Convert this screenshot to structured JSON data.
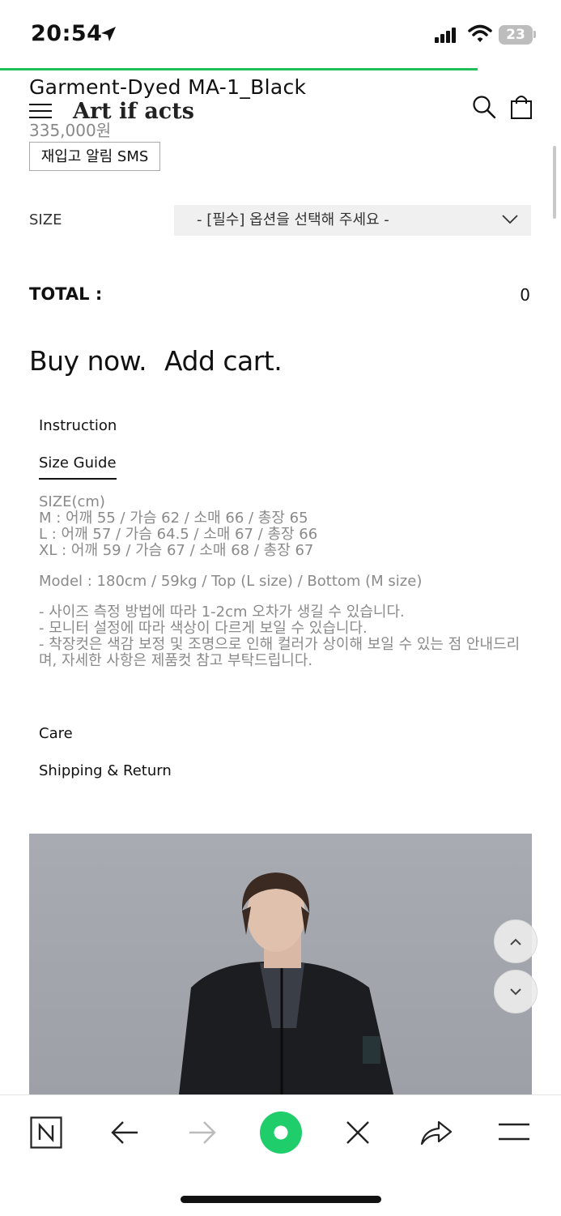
{
  "status_bar": {
    "time": "20:54",
    "battery": "23"
  },
  "header": {
    "logo": "Art if acts"
  },
  "product": {
    "title": "Garment-Dyed MA-1_Black",
    "price": "335,000원",
    "restock_button": "재입고 알림 SMS"
  },
  "options": {
    "size_label": "SIZE",
    "select_placeholder": "- [필수] 옵션을 선택해 주세요 -"
  },
  "total": {
    "label": "TOTAL :",
    "value": "0"
  },
  "actions": {
    "buy_now": "Buy now.",
    "add_cart": "Add cart."
  },
  "tabs": {
    "instruction": "Instruction",
    "size_guide": "Size Guide",
    "care": "Care",
    "shipping": "Shipping & Return"
  },
  "size_guide": {
    "unit": "SIZE(cm)",
    "sizes": [
      "M : 어깨 55 / 가슴 62 / 소매 66 / 총장 65",
      "L : 어깨 57 / 가슴 64.5 / 소매 67 / 총장 66",
      "XL : 어깨 59 / 가슴 67 / 소매 68 / 총장 67"
    ],
    "model": "Model : 180cm / 59kg / Top (L size) / Bottom (M size)",
    "notes": [
      "- 사이즈 측정 방법에 따라 1-2cm 오차가 생길 수 있습니다.",
      "- 모니터 설정에 따라 색상이 다르게 보일 수 있습니다.",
      "- 착장컷은 색감 보정 및 조명으로 인해 컬러가 상이해 보일 수 있는 점 안내드리며, 자세한 사항은 제품컷 참고 부탁드립니다."
    ]
  },
  "colors": {
    "accent": "#1fbf5a",
    "muted_text": "#8a8a8a"
  },
  "bottom_bar": {
    "icons": [
      "naver-icon",
      "back-icon",
      "forward-icon",
      "green-dot-icon",
      "close-icon",
      "share-icon",
      "menu-icon"
    ]
  }
}
